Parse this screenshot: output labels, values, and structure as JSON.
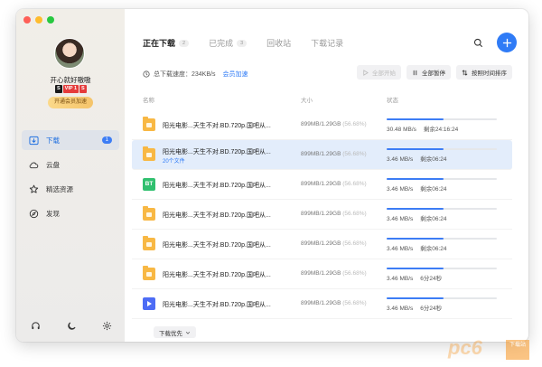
{
  "colors": {
    "accent": "#2f7bf6",
    "vip": "#f5c46a",
    "bt": "#30c06f",
    "folder": "#f8b844"
  },
  "sidebar": {
    "username": "开心就好嗷嗷",
    "badges": [
      "S",
      "VIP 1",
      "S"
    ],
    "vip_button": "开通会员加速",
    "items": [
      {
        "label": "下载",
        "icon": "download-icon",
        "badge": "1"
      },
      {
        "label": "云盘",
        "icon": "cloud-icon"
      },
      {
        "label": "精选资源",
        "icon": "star-icon"
      },
      {
        "label": "发现",
        "icon": "compass-icon"
      }
    ]
  },
  "tabs": [
    {
      "label": "正在下载",
      "count": "2"
    },
    {
      "label": "已完成",
      "count": "3"
    },
    {
      "label": "回收站",
      "count": ""
    },
    {
      "label": "下载记录",
      "count": ""
    }
  ],
  "speed": {
    "text": "总下载速度：234KB/s",
    "link": "会员加速"
  },
  "actions": {
    "start_all": "全部开始",
    "pause_all": "全部暂停",
    "sort": "按照时间排序"
  },
  "table": {
    "headers": {
      "name": "名称",
      "size": "大小",
      "status": "状态"
    },
    "rows": [
      {
        "icon": "folder",
        "name": "阳光电影...天生不对.BD.720p.国吧从...",
        "sub": "",
        "size": "899MB/1.29GB",
        "pct": "(56.68%)",
        "progress": 0.52,
        "speed": "30.48 MB/s",
        "remain": "剩余24:16:24"
      },
      {
        "icon": "folder",
        "name": "阳光电影...天生不对.BD.720p.国吧从...",
        "sub": "20个文件",
        "size": "899MB/1.29GB",
        "pct": "(56.68%)",
        "progress": 0.52,
        "speed": "3.46 MB/s",
        "remain": "剩余06:24"
      },
      {
        "icon": "bt",
        "name": "阳光电影...天生不对.BD.720p.国吧从...",
        "sub": "",
        "size": "899MB/1.29GB",
        "pct": "(56.68%)",
        "progress": 0.52,
        "speed": "3.46 MB/s",
        "remain": "剩余06:24"
      },
      {
        "icon": "folder",
        "name": "阳光电影...天生不对.BD.720p.国吧从...",
        "sub": "",
        "size": "899MB/1.29GB",
        "pct": "(56.68%)",
        "progress": 0.52,
        "speed": "3.46 MB/s",
        "remain": "剩余06:24"
      },
      {
        "icon": "folder",
        "name": "阳光电影...天生不对.BD.720p.国吧从...",
        "sub": "",
        "size": "899MB/1.29GB",
        "pct": "(56.68%)",
        "progress": 0.52,
        "speed": "3.46 MB/s",
        "remain": "剩余06:24"
      },
      {
        "icon": "folder",
        "name": "阳光电影...天生不对.BD.720p.国吧从...",
        "sub": "",
        "size": "899MB/1.29GB",
        "pct": "(56.68%)",
        "progress": 0.52,
        "speed": "3.46 MB/s",
        "remain": "6分24秒"
      },
      {
        "icon": "video",
        "name": "阳光电影...天生不对.BD.720p.国吧从...",
        "sub": "",
        "size": "899MB/1.29GB",
        "pct": "(56.68%)",
        "progress": 0.52,
        "speed": "3.46 MB/s",
        "remain": "6分24秒"
      }
    ]
  },
  "priority_button": "下载优先",
  "watermark": {
    "logo": "pc6",
    "text": "下载站"
  }
}
